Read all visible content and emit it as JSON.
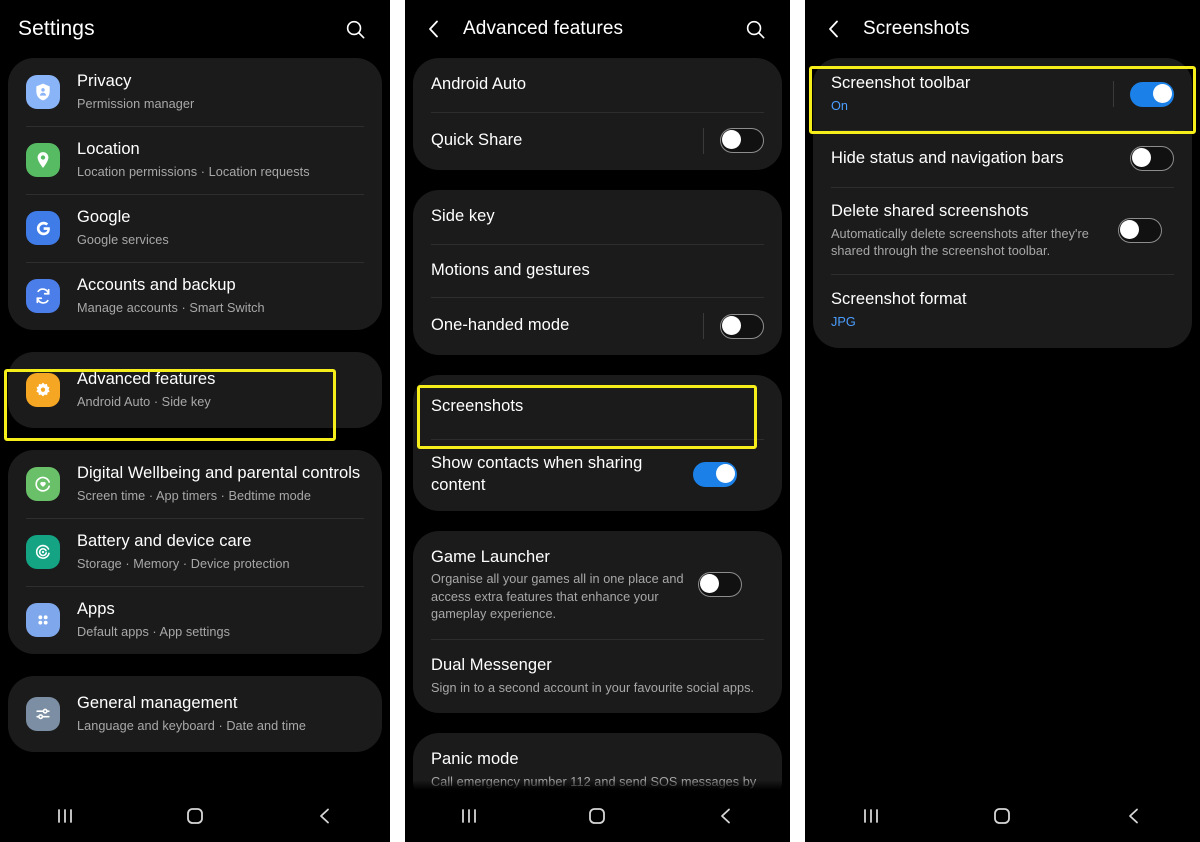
{
  "colors": {
    "highlight": "#f5ee1a",
    "toggle_on": "#1b81e8",
    "accent_text": "#4a9eff",
    "card_bg": "#1b1b1b",
    "screen_bg": "#000000",
    "subtitle": "#a8a8a8"
  },
  "panel1": {
    "header": {
      "title": "Settings",
      "search_icon": "search-icon"
    },
    "groups": [
      {
        "items": [
          {
            "title": "Privacy",
            "subtitle": "Permission manager",
            "icon": "privacy-shield-icon",
            "icon_color": "#8ab4f8"
          },
          {
            "title": "Location",
            "subtitle": "Location permissions  ·  Location requests",
            "icon": "location-pin-icon",
            "icon_color": "#57bb63"
          },
          {
            "title": "Google",
            "subtitle": "Google services",
            "icon": "google-g-icon",
            "icon_color": "#3f7ce8"
          },
          {
            "title": "Accounts and backup",
            "subtitle": "Manage accounts  ·  Smart Switch",
            "icon": "sync-accounts-icon",
            "icon_color": "#4b7ee8"
          }
        ]
      },
      {
        "highlighted": true,
        "items": [
          {
            "title": "Advanced features",
            "subtitle": "Android Auto  ·  Side key",
            "icon": "advanced-features-gear-icon",
            "icon_color": "#f5a623"
          }
        ]
      },
      {
        "items": [
          {
            "title": "Digital Wellbeing and parental controls",
            "subtitle": "Screen time  ·  App timers  ·  Bedtime mode",
            "icon": "digital-wellbeing-icon",
            "icon_color": "#6abf69"
          },
          {
            "title": "Battery and device care",
            "subtitle": "Storage  ·  Memory  ·  Device protection",
            "icon": "battery-device-care-icon",
            "icon_color": "#14a383"
          },
          {
            "title": "Apps",
            "subtitle": "Default apps  ·  App settings",
            "icon": "apps-grid-icon",
            "icon_color": "#7fa8ec"
          }
        ]
      },
      {
        "items": [
          {
            "title": "General management",
            "subtitle": "Language and keyboard  ·  Date and time",
            "icon": "sliders-icon",
            "icon_color": "#7b8ea3"
          }
        ]
      }
    ],
    "navbar": {
      "recents": "recents-icon",
      "home": "home-icon",
      "back": "back-icon"
    }
  },
  "panel2": {
    "header": {
      "back_icon": "back-chevron-icon",
      "title": "Advanced features",
      "search_icon": "search-icon"
    },
    "groups": [
      {
        "items": [
          {
            "title": "Android Auto",
            "toggle": null
          },
          {
            "title": "Quick Share",
            "toggle": "off"
          }
        ]
      },
      {
        "items": [
          {
            "title": "Side key",
            "toggle": null
          },
          {
            "title": "Motions and gestures",
            "toggle": null
          },
          {
            "title": "One-handed mode",
            "toggle": "off"
          }
        ]
      },
      {
        "highlighted": true,
        "items": [
          {
            "title": "Screenshots",
            "toggle": null
          },
          {
            "title": "Show contacts when sharing content",
            "toggle": "on"
          }
        ]
      },
      {
        "items": [
          {
            "title": "Game Launcher",
            "subtitle": "Organise all your games all in one place and access extra features that enhance your gameplay experience.",
            "toggle": "off"
          },
          {
            "title": "Dual Messenger",
            "subtitle": "Sign in to a second account in your favourite social apps.",
            "toggle": null
          }
        ]
      },
      {
        "items": [
          {
            "title": "Panic mode",
            "subtitle": "Call emergency number 112 and send SOS messages by",
            "toggle": null
          }
        ]
      }
    ],
    "navbar": {
      "recents": "recents-icon",
      "home": "home-icon",
      "back": "back-icon"
    }
  },
  "panel3": {
    "header": {
      "back_icon": "back-chevron-icon",
      "title": "Screenshots"
    },
    "groups": [
      {
        "items": [
          {
            "title": "Screenshot toolbar",
            "subtitle": "On",
            "subtitle_accent": true,
            "toggle": "on",
            "highlighted": true
          },
          {
            "title": "Hide status and navigation bars",
            "toggle": "off"
          },
          {
            "title": "Delete shared screenshots",
            "subtitle": "Automatically delete screenshots after they're shared through the screenshot toolbar.",
            "toggle": "off"
          },
          {
            "title": "Screenshot format",
            "subtitle": "JPG",
            "subtitle_accent": true,
            "toggle": null
          }
        ]
      }
    ],
    "navbar": {
      "recents": "recents-icon",
      "home": "home-icon",
      "back": "back-icon"
    }
  }
}
